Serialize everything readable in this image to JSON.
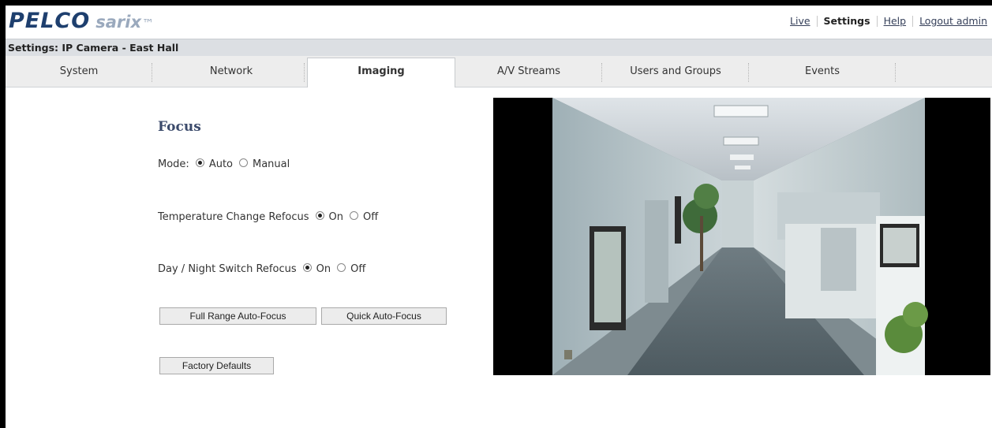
{
  "header": {
    "logo_brand": "PELCO",
    "logo_product": "sarix",
    "logo_tm": "™",
    "links": {
      "live": "Live",
      "settings": "Settings",
      "help": "Help",
      "logout": "Logout admin"
    }
  },
  "breadcrumb": "Settings: IP Camera - East Hall",
  "tabs": [
    {
      "label": "System"
    },
    {
      "label": "Network"
    },
    {
      "label": "Imaging",
      "active": true
    },
    {
      "label": "A/V Streams"
    },
    {
      "label": "Users and Groups"
    },
    {
      "label": "Events"
    }
  ],
  "focus": {
    "title": "Focus",
    "mode": {
      "label": "Mode:",
      "options": [
        "Auto",
        "Manual"
      ],
      "selected": "Auto"
    },
    "temperature_refocus": {
      "label": "Temperature Change Refocus",
      "options": [
        "On",
        "Off"
      ],
      "selected": "On"
    },
    "day_night_refocus": {
      "label": "Day / Night Switch Refocus",
      "options": [
        "On",
        "Off"
      ],
      "selected": "On"
    },
    "buttons": {
      "full_range": "Full Range Auto-Focus",
      "quick": "Quick Auto-Focus",
      "factory_defaults": "Factory Defaults"
    }
  },
  "colors": {
    "brand": "#1e3f6e",
    "breadcrumb_bg": "#dcdfe3",
    "tabbar_bg": "#ededed",
    "section_title": "#3b4a6b"
  }
}
